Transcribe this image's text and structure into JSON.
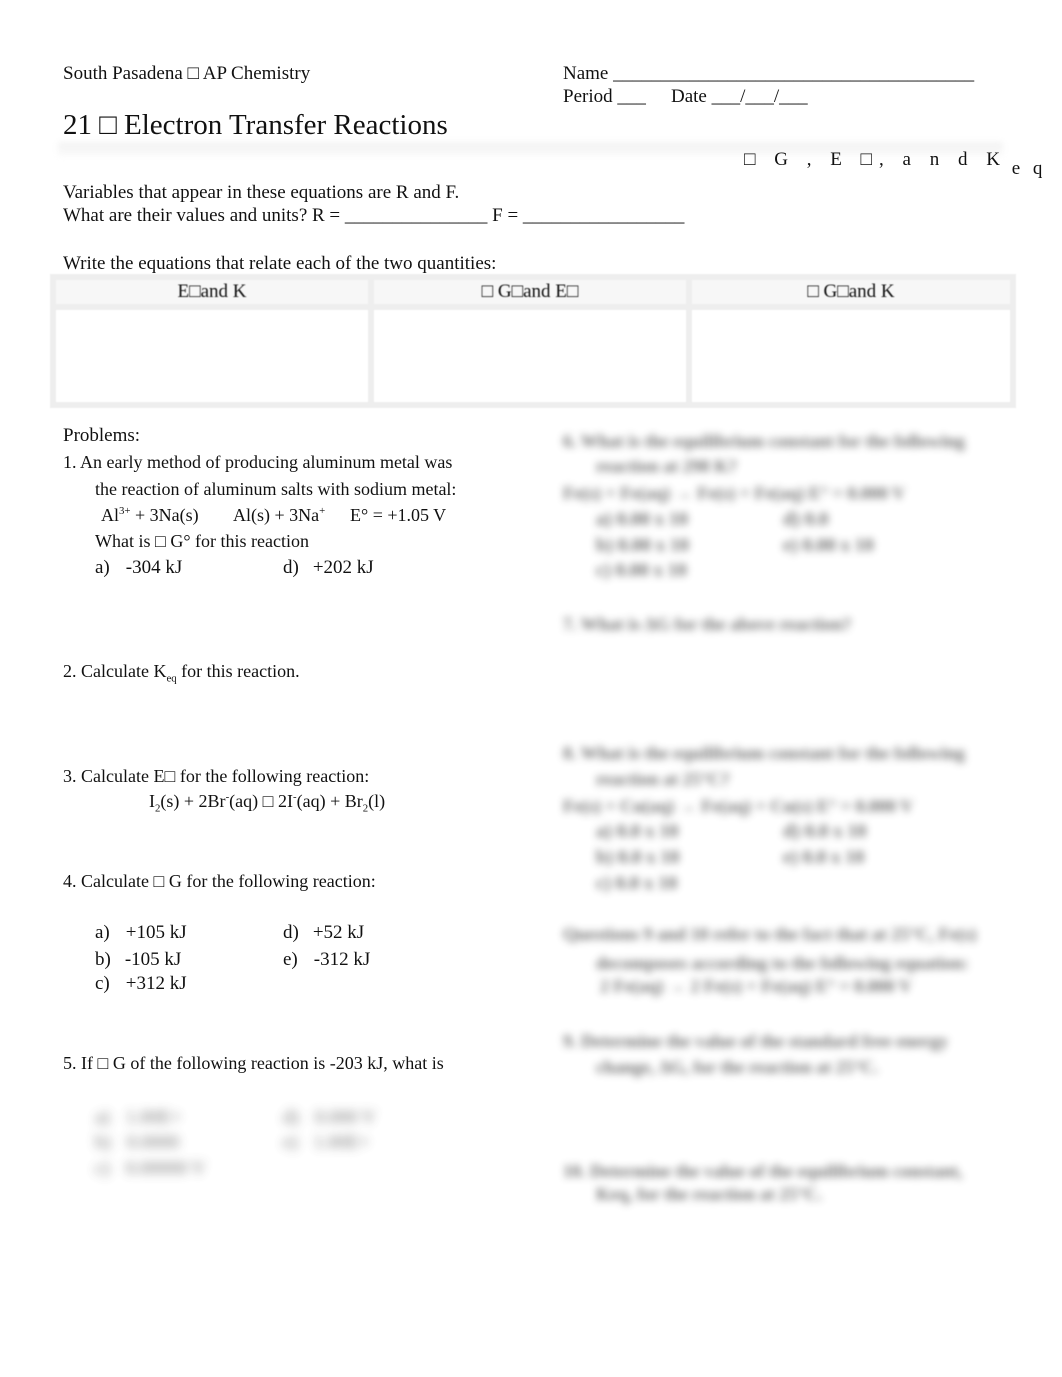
{
  "header": {
    "course": "South Pasadena □ AP Chemistry",
    "name_label": "Name ______________________________________",
    "period_label": "Period ___",
    "date_label": "Date ___/___/___",
    "title": "21  □ Electron Transfer Reactions",
    "subtitle_main": "□ G , E □, a n d K",
    "subtitle_sub": "e q"
  },
  "intro": {
    "line1": "Variables that appear in these equations are R and F.",
    "line2": "What are their values and units?  R = _______________  F = _________________",
    "equations_prompt": "Write the equations that relate each of the two quantities:"
  },
  "equation_table": {
    "headers": [
      "E□and K",
      "□ G□and E□",
      "□ G□and K"
    ],
    "cells": [
      "",
      "",
      ""
    ]
  },
  "problems": {
    "heading": "Problems:",
    "p1": {
      "line1": "1.  An early method of producing aluminum metal was",
      "line2": "the reaction of aluminum salts with sodium metal:",
      "eq_al": "Al",
      "eq_al_sup": "3+",
      "eq_rest1": " + 3Na(s)",
      "eq_product": "Al(s) + 3Na",
      "eq_product_sup": "+",
      "eq_e": "E° = +1.05 V",
      "question": "What is □ G° for this reaction",
      "options": [
        {
          "letter": "a)",
          "value": "-304 kJ"
        },
        {
          "letter": "d)",
          "value": "+202 kJ"
        }
      ]
    },
    "p2": {
      "prefix": "2.   Calculate K",
      "sub": "eq",
      "suffix": " for this reaction."
    },
    "p3": {
      "text": "3.  Calculate E□ for the following reaction:",
      "eq_i": "I",
      "eq_i_sub": "2",
      "eq_part1": "(s) + 2Br",
      "eq_part1_sup": "-",
      "eq_part2": "(aq) □  2I",
      "eq_part2_sup": "-",
      "eq_part3": "(aq) + Br",
      "eq_part3_sub": "2",
      "eq_part4": "(l)"
    },
    "p4": {
      "text": "4.  Calculate □ G for the following reaction:",
      "options": [
        {
          "letter": "a)",
          "value": "+105 kJ"
        },
        {
          "letter": "b)",
          "value": "-105 kJ"
        },
        {
          "letter": "c)",
          "value": "+312 kJ"
        },
        {
          "letter": "d)",
          "value": "+52 kJ"
        },
        {
          "letter": "e)",
          "value": "-312 kJ"
        }
      ]
    },
    "p5": {
      "text": "5.  If □ G of the following reaction is -203 kJ, what is",
      "blurred_options": [
        {
          "letter": "a)",
          "value": "1.00E+"
        },
        {
          "letter": "b)",
          "value": "0.0000"
        },
        {
          "letter": "c)",
          "value": "0.00000 V"
        },
        {
          "letter": "d)",
          "value": "0.000 V"
        },
        {
          "letter": "e)",
          "value": "1.00E+"
        }
      ]
    }
  },
  "right_column_blurred": {
    "q6_line1": "6.  What is the equilibrium constant for the following",
    "q6_line2": "reaction at 298 K?",
    "q6_eq": "Fe(s) + Fe(aq) → Fe(s) + Fe(aq)  E° = 0.000 V",
    "q6_options": [
      "a)  0.00 x 10",
      "d)  0.0",
      "b)  0.00 x 10",
      "e)  0.00 x 10",
      "c)  0.00 x 10"
    ],
    "q7": "7.   What is ΔG for the above reaction?",
    "q8_line1": "8.  What is the equilibrium constant for the following",
    "q8_line2": "reaction at 25°C?",
    "q8_eq": "Fe(s) + Cu(aq) → Fe(aq) + Cu(s)  E° = 0.000 V",
    "q8_options": [
      "a)  0.0 x 10",
      "d)  0.0 x 10",
      "b)  0.0 x 10",
      "e)  0.0 x 10",
      "c)  0.0 x 10"
    ],
    "q9_intro_line1": "Questions 9 and 10 refer to the fact that at 25°C, Fe(s)",
    "q9_intro_line2": "decomposes according to the following equation:",
    "q9_intro_line3": "2 Fe(aq) → 2 Fe(s) + Fe(aq)  E° = 0.000 V",
    "q9_line1": "9.   Determine the value of the standard free energy",
    "q9_line2": "change, ΔG, for the reaction at 25°C.",
    "q10_line1": "10.  Determine the value of the equilibrium constant,",
    "q10_line2": "Keq, for the reaction at 25°C."
  }
}
